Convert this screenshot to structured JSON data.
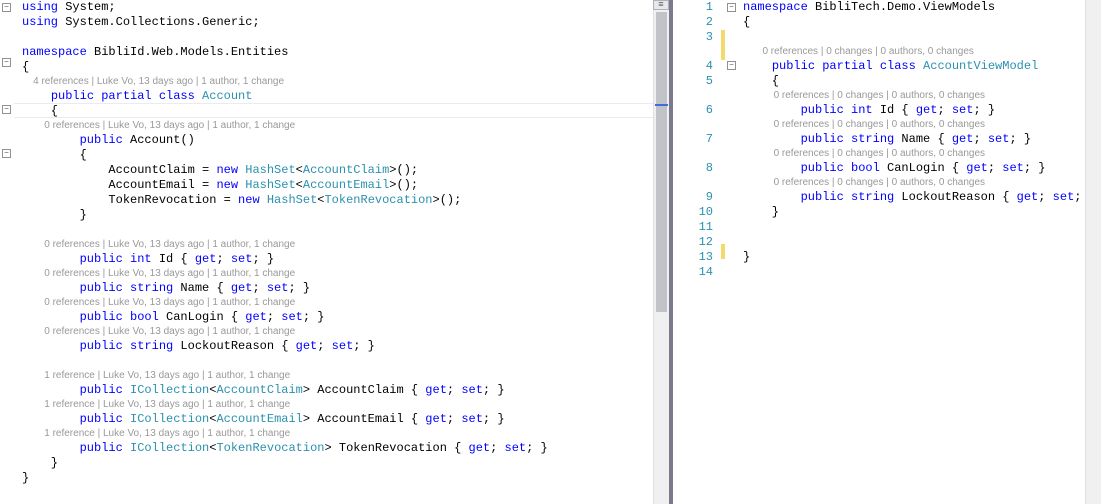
{
  "left": {
    "codelens": {
      "ref0": "0 references | Luke Vo, 13 days ago | 1 author, 1 change",
      "ref1": "1 reference | Luke Vo, 13 days ago | 1 author, 1 change",
      "ref4": "4 references | Luke Vo, 13 days ago | 1 author, 1 change"
    },
    "l1_using": "using",
    "l1_sys": " System;",
    "l2_using": "using",
    "l2_rest": " System.Collections.Generic;",
    "l3": "",
    "l4_ns": "namespace",
    "l4_rest": " BibliId.Web.Models.Entities",
    "l5": "{",
    "l7a": "    ",
    "l7b": "public partial class",
    "l7c": " ",
    "l7d": "Account",
    "l8": "    {",
    "l10a": "        ",
    "l10b": "public",
    "l10c": " Account()",
    "l11": "        {",
    "l12a": "            AccountClaim = ",
    "l12b": "new",
    "l12c": " ",
    "l12d": "HashSet",
    "l12e": "<",
    "l12f": "AccountClaim",
    "l12g": ">();",
    "l13a": "            AccountEmail = ",
    "l13b": "new",
    "l13c": " ",
    "l13d": "HashSet",
    "l13e": "<",
    "l13f": "AccountEmail",
    "l13g": ">();",
    "l14a": "            TokenRevocation = ",
    "l14b": "new",
    "l14c": " ",
    "l14d": "HashSet",
    "l14e": "<",
    "l14f": "TokenRevocation",
    "l14g": ">();",
    "l15": "        }",
    "l16": "",
    "l18a": "        ",
    "l18b": "public int",
    "l18c": " Id { ",
    "l18d": "get",
    "l18e": "; ",
    "l18f": "set",
    "l18g": "; }",
    "l20a": "        ",
    "l20b": "public string",
    "l20c": " Name { ",
    "l20d": "get",
    "l20e": "; ",
    "l20f": "set",
    "l20g": "; }",
    "l22a": "        ",
    "l22b": "public bool",
    "l22c": " CanLogin { ",
    "l22d": "get",
    "l22e": "; ",
    "l22f": "set",
    "l22g": "; }",
    "l24a": "        ",
    "l24b": "public string",
    "l24c": " LockoutReason { ",
    "l24d": "get",
    "l24e": "; ",
    "l24f": "set",
    "l24g": "; }",
    "l25": "",
    "l27a": "        ",
    "l27b": "public",
    "l27c": " ",
    "l27d": "ICollection",
    "l27e": "<",
    "l27f": "AccountClaim",
    "l27g": "> AccountClaim { ",
    "l27h": "get",
    "l27i": "; ",
    "l27j": "set",
    "l27k": "; }",
    "l29a": "        ",
    "l29b": "public",
    "l29c": " ",
    "l29d": "ICollection",
    "l29e": "<",
    "l29f": "AccountEmail",
    "l29g": "> AccountEmail { ",
    "l29h": "get",
    "l29i": "; ",
    "l29j": "set",
    "l29k": "; }",
    "l31a": "        ",
    "l31b": "public",
    "l31c": " ",
    "l31d": "ICollection",
    "l31e": "<",
    "l31f": "TokenRevocation",
    "l31g": "> TokenRevocation { ",
    "l31h": "get",
    "l31i": "; ",
    "l31j": "set",
    "l31k": "; }",
    "l32": "    }",
    "l33": "}"
  },
  "right": {
    "codelens0": "0 references | 0 changes | 0 authors, 0 changes",
    "lnums": [
      "1",
      "2",
      "3",
      "4",
      "5",
      "6",
      "7",
      "8",
      "9",
      "10",
      "11",
      "12",
      "13",
      "14"
    ],
    "r1a": "namespace",
    "r1b": " BibliTech.Demo.ViewModels",
    "r2": "{",
    "r4a": "    ",
    "r4b": "public partial class",
    "r4c": " ",
    "r4d": "AccountViewModel",
    "r5": "    {",
    "r6a": "        ",
    "r6b": "public int",
    "r6c": " Id { ",
    "r6d": "get",
    "r6e": "; ",
    "r6f": "set",
    "r6g": "; }",
    "r7a": "        ",
    "r7b": "public string",
    "r7c": " Name { ",
    "r7d": "get",
    "r7e": "; ",
    "r7f": "set",
    "r7g": "; }",
    "r8a": "        ",
    "r8b": "public bool",
    "r8c": " CanLogin { ",
    "r8d": "get",
    "r8e": "; ",
    "r8f": "set",
    "r8g": "; }",
    "r9a": "        ",
    "r9b": "public string",
    "r9c": " LockoutReason { ",
    "r9d": "get",
    "r9e": "; ",
    "r9f": "set",
    "r9g": "; }",
    "r10": "    }",
    "r13": "}"
  }
}
